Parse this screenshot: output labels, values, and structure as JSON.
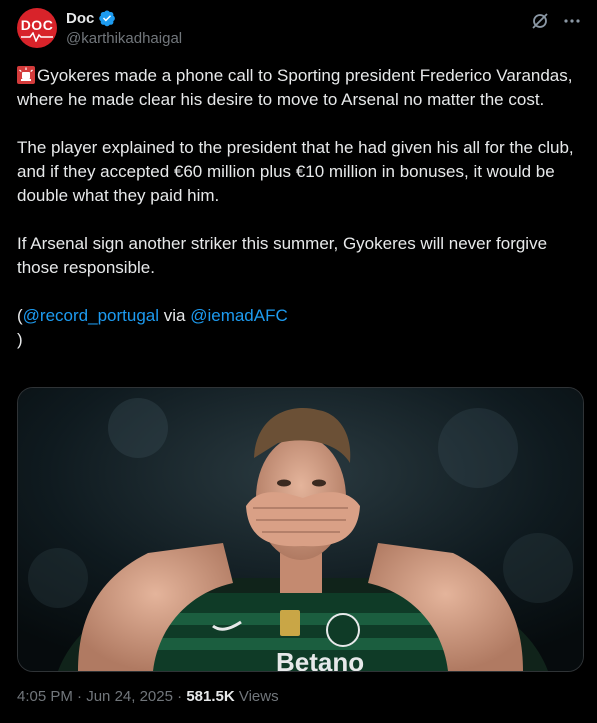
{
  "author": {
    "display_name": "Doc",
    "handle": "@karthikadhaigal",
    "avatar_text": "DOC",
    "verified": true
  },
  "actions": {
    "grok_icon": "grok-icon",
    "more_icon": "more-icon"
  },
  "body": {
    "p1_emoji": "rotating-light-icon",
    "p1": "Gyokeres made a phone call to Sporting president Frederico Varandas, where he made clear his desire to move to Arsenal no matter the cost.",
    "p2": "The player explained to the president that he had given his all for the club, and if they accepted €60 million plus €10 million in bonuses, it would be double what they paid him.",
    "p3": "If Arsenal sign another striker this summer, Gyokeres will never forgive those responsible.",
    "p4_open": "(",
    "p4_mention1": "@record_portugal",
    "p4_via": " via ",
    "p4_mention2": "@iemadAFC",
    "p4_close": ")"
  },
  "meta": {
    "time": "4:05 PM",
    "sep1": " · ",
    "date": "Jun 24, 2025",
    "sep2": " · ",
    "views_count": "581.5K",
    "views_label": " Views"
  },
  "colors": {
    "background": "#000000",
    "text": "#e7e9ea",
    "secondary": "#71767b",
    "link": "#1d9bf0",
    "verified": "#1d9bf0",
    "avatar": "#d8232a"
  }
}
